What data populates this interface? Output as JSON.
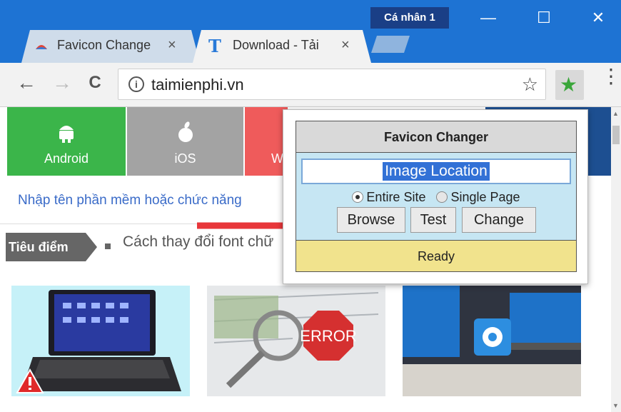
{
  "window": {
    "profile_label": "Cá nhân 1",
    "minimize_glyph": "—",
    "maximize_glyph": "☐",
    "close_glyph": "✕"
  },
  "tabs": [
    {
      "title": "Favicon Change",
      "close": "×",
      "icon": "favicon-changer-icon"
    },
    {
      "title": "Download - Tải",
      "close": "×",
      "icon": "taimienphi-t-icon"
    }
  ],
  "toolbar": {
    "back": "←",
    "forward": "→",
    "reload": "C",
    "info": "i",
    "url": "taimienphi.vn",
    "bookmark": "☆",
    "extension_icon": "green-star-icon",
    "menu": "⋮"
  },
  "page": {
    "categories": [
      {
        "label": "Android",
        "icon": "android-icon",
        "color": "#3bb54a"
      },
      {
        "label": "iOS",
        "icon": "apple-icon",
        "color": "#a3a3a3"
      },
      {
        "label": "W",
        "icon": "windows-icon",
        "color": "#ef5b5b"
      }
    ],
    "search_placeholder": "Nhập tên phần mềm hoặc chức năng",
    "featured_badge": "Tiêu điểm",
    "headline": "Cách thay đổi font chữ"
  },
  "popup": {
    "title": "Favicon Changer",
    "input_value": "Image Location",
    "radio_entire": "Entire Site",
    "radio_single": "Single Page",
    "browse": "Browse",
    "test": "Test",
    "change": "Change",
    "status": "Ready"
  },
  "colors": {
    "titlebar": "#1e73d3",
    "arrow": "#e8363a",
    "status_bg": "#f1e38d",
    "popup_body": "#c6e6f3"
  }
}
